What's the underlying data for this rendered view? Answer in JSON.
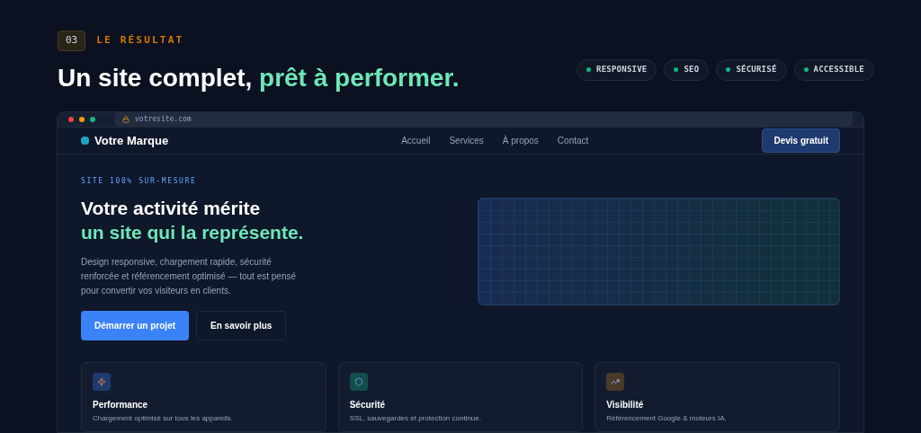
{
  "section": {
    "number": "03",
    "eyebrow": "LE RÉSULTAT",
    "title_main": "Un site complet,",
    "title_accent": "prêt à performer."
  },
  "tags": [
    {
      "label": "RESPONSIVE",
      "color": "#10b981"
    },
    {
      "label": "SEO",
      "color": "#10b981"
    },
    {
      "label": "SÉCURISÉ",
      "color": "#10b981"
    },
    {
      "label": "ACCESSIBLE",
      "color": "#10b981"
    }
  ],
  "browser": {
    "url": "votresite.com"
  },
  "site": {
    "brand": "Votre Marque",
    "nav": [
      "Accueil",
      "Services",
      "À propos",
      "Contact"
    ],
    "cta": "Devis gratuit",
    "hero": {
      "eyebrow": "SITE 100% SUR-MESURE",
      "title_main": "Votre activité mérite",
      "title_accent": "un site qui la représente.",
      "text": "Design responsive, chargement rapide, sécurité renforcée et référencement optimisé — tout est pensé pour convertir vos visiteurs en clients.",
      "primary": "Démarrer un projet",
      "secondary": "En savoir plus"
    },
    "features": [
      {
        "kind": "bolt",
        "title": "Performance",
        "text": "Chargement optimisé sur tous les appareils."
      },
      {
        "kind": "shield",
        "title": "Sécurité",
        "text": "SSL, sauvegardes et protection continue."
      },
      {
        "kind": "chart",
        "title": "Visibilité",
        "text": "Référencement Google & moteurs IA."
      }
    ]
  }
}
